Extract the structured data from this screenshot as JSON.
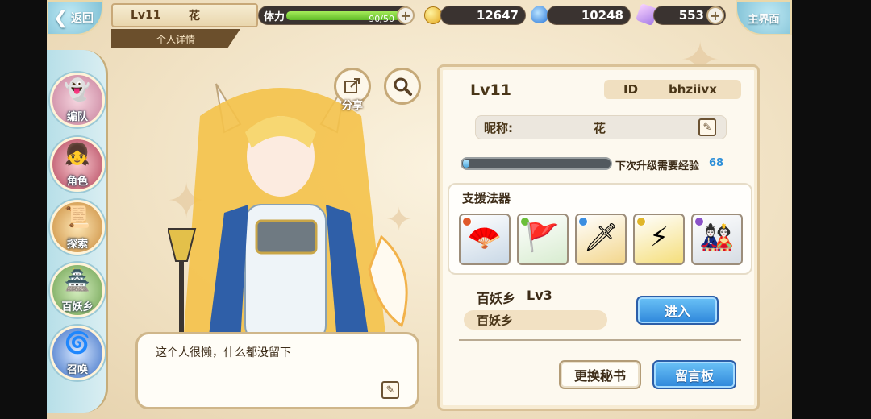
{
  "top_bar": {
    "back_label": "返回",
    "player_level": "Lv11",
    "player_name": "花",
    "detail_tab": "个人详情",
    "stamina_label": "体力",
    "stamina_value": "90/50",
    "stamina_fill": 1.0,
    "gold": "12647",
    "spirit": "10248",
    "crystal": "553",
    "home_label": "主界面"
  },
  "nav": {
    "items": [
      {
        "label": "编队",
        "icon": "team-icon"
      },
      {
        "label": "角色",
        "icon": "character-icon"
      },
      {
        "label": "探索",
        "icon": "explore-icon"
      },
      {
        "label": "百妖乡",
        "icon": "village-icon"
      },
      {
        "label": "召唤",
        "icon": "summon-icon"
      }
    ]
  },
  "character": {
    "share_label": "分享",
    "bio": "这个人很懒，什么都没留下"
  },
  "profile": {
    "level": "Lv11",
    "id_label": "ID",
    "id_value": "bhziivx",
    "nickname_label": "昵称:",
    "nickname_value": "花",
    "xp_label": "下次升级需要经验",
    "xp_value": "68",
    "xp_fill": 0.02,
    "support_title": "支援法器",
    "artifacts": [
      {
        "name": "artifact-1",
        "color": "#c9d8e6",
        "gem": "#e0592a"
      },
      {
        "name": "artifact-2",
        "color": "#d8ecd0",
        "gem": "#6bbf3a"
      },
      {
        "name": "artifact-3",
        "color": "#f3d68c",
        "gem": "#3b8ee0"
      },
      {
        "name": "artifact-4",
        "color": "#f5de7a",
        "gem": "#e0b62a"
      },
      {
        "name": "artifact-5",
        "color": "#d6dce3",
        "gem": "#8a52c8"
      }
    ],
    "village_name": "百妖乡",
    "village_level": "Lv3",
    "village_field": "百妖乡",
    "enter_label": "进入",
    "change_secretary_label": "更换秘书",
    "message_board_label": "留言板"
  }
}
